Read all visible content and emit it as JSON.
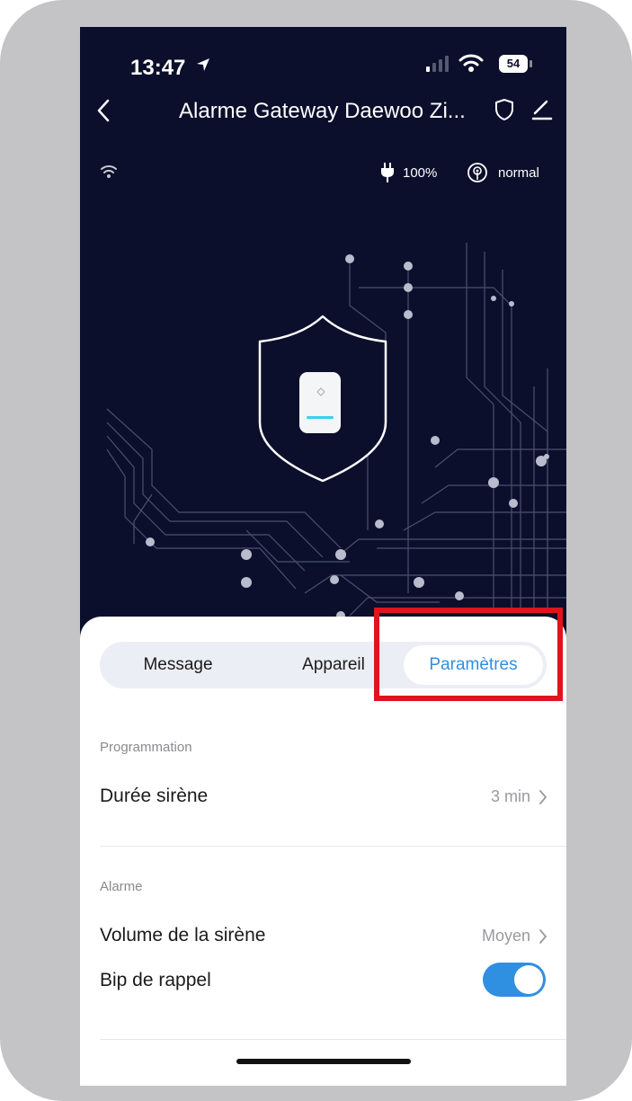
{
  "status_bar": {
    "time": "13:47",
    "battery": "54"
  },
  "nav": {
    "title": "Alarme Gateway Daewoo Zi..."
  },
  "device_info": {
    "power": "100%",
    "signal": "normal"
  },
  "tabs": {
    "message": "Message",
    "appareil": "Appareil",
    "parametres": "Paramètres"
  },
  "settings": {
    "section_programmation": "Programmation",
    "duree_sirene_label": "Durée sirène",
    "duree_sirene_value": "3 min",
    "section_alarme": "Alarme",
    "volume_label": "Volume de la sirène",
    "volume_value": "Moyen",
    "bip_label": "Bip de rappel",
    "bip_enabled": true
  },
  "colors": {
    "accent": "#2f8fe0",
    "header_bg": "#0b0f2b",
    "highlight": "#e0141e"
  }
}
